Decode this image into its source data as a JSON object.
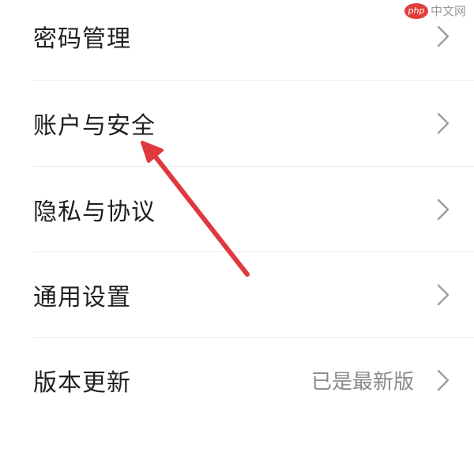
{
  "settings": {
    "items": [
      {
        "label": "密码管理",
        "value": ""
      },
      {
        "label": "账户与安全",
        "value": ""
      },
      {
        "label": "隐私与协议",
        "value": ""
      },
      {
        "label": "通用设置",
        "value": ""
      },
      {
        "label": "版本更新",
        "value": "已是最新版"
      }
    ]
  },
  "watermark": {
    "logo_text": "php",
    "site_text": "中文网"
  },
  "annotation": {
    "arrow_color": "#e0383f"
  },
  "colors": {
    "label": "#1f1f1f",
    "value": "#8a8a8a",
    "chevron": "#9e9e9e",
    "divider": "#ececec"
  }
}
